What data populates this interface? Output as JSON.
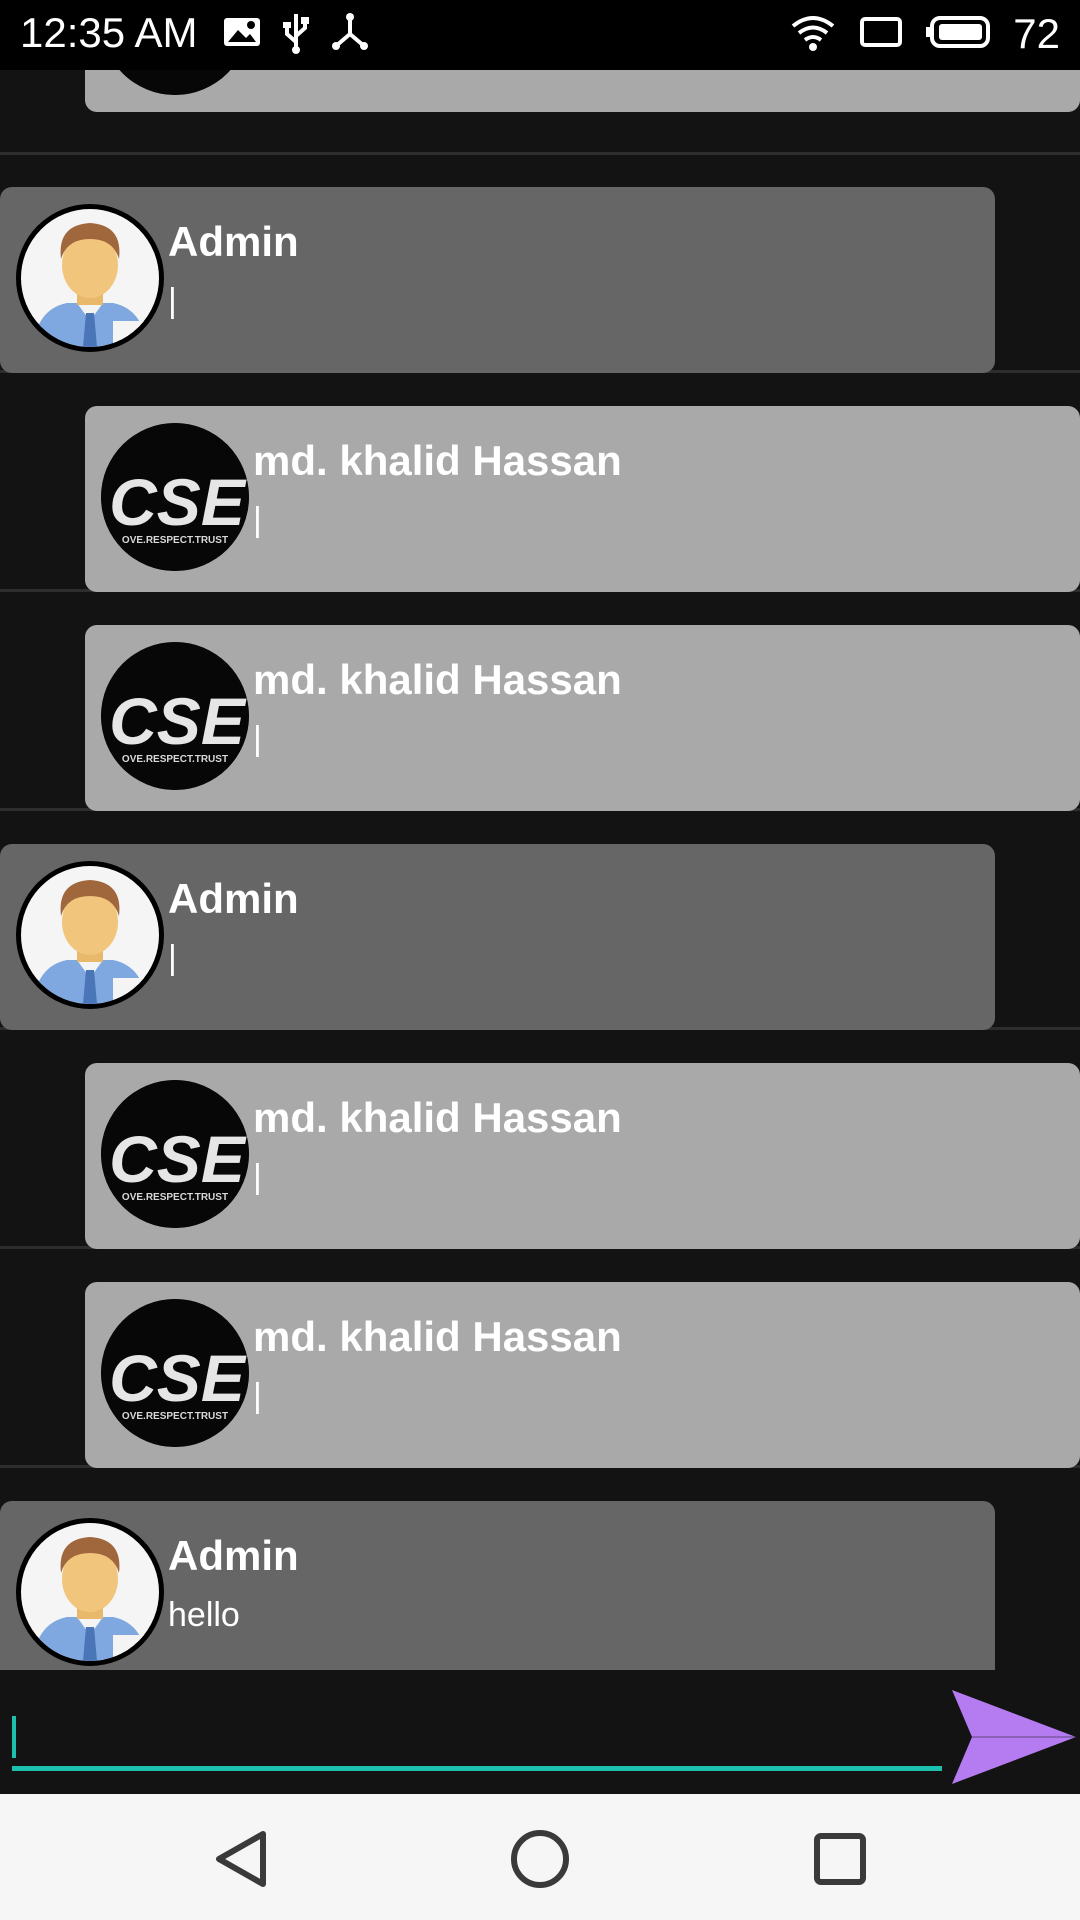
{
  "status_bar": {
    "time": "12:35 AM",
    "battery": "72"
  },
  "messages": [
    {
      "sender": "",
      "text": "",
      "kind": "user"
    },
    {
      "sender": "Admin",
      "text": "|",
      "kind": "admin"
    },
    {
      "sender": "md. khalid Hassan",
      "text": "|",
      "kind": "user"
    },
    {
      "sender": "md. khalid Hassan",
      "text": "|",
      "kind": "user"
    },
    {
      "sender": "Admin",
      "text": "|",
      "kind": "admin"
    },
    {
      "sender": "md. khalid Hassan",
      "text": "|",
      "kind": "user"
    },
    {
      "sender": "md. khalid Hassan",
      "text": "|",
      "kind": "user"
    },
    {
      "sender": "Admin",
      "text": "hello",
      "kind": "admin"
    }
  ],
  "avatars": {
    "cse_logo_text": "CSE",
    "cse_tagline": "OVE.RESPECT.TRUST"
  },
  "input": {
    "value": "",
    "placeholder": ""
  },
  "icons": {
    "send": "send-arrow-icon",
    "nav_back": "back-triangle-icon",
    "nav_home": "home-circle-icon",
    "nav_recents": "recents-square-icon"
  },
  "colors": {
    "admin_bubble": "#666666",
    "user_bubble": "#a9a9a9",
    "input_accent": "#1dbfaf",
    "send_button": "#b57cf1"
  }
}
